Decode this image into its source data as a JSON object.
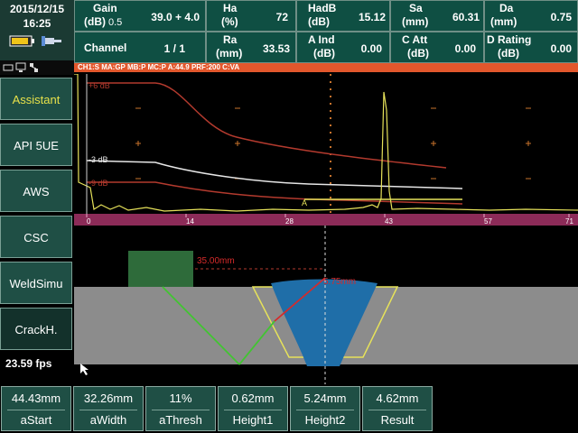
{
  "status": {
    "date": "2015/12/15",
    "time": "16:25"
  },
  "params": {
    "gain": {
      "label1": "Gain",
      "label2": "(dB)",
      "step": "0.5",
      "value": "39.0 + 4.0"
    },
    "channel": {
      "label": "Channel",
      "value": "1 / 1"
    },
    "ha": {
      "label1": "Ha",
      "label2": "(%)",
      "value": "72"
    },
    "hadb": {
      "label1": "HadB",
      "label2": "(dB)",
      "value": "15.12"
    },
    "sa": {
      "label1": "Sa",
      "label2": "(mm)",
      "value": "60.31"
    },
    "da": {
      "label1": "Da",
      "label2": "(mm)",
      "value": "0.75"
    },
    "ra": {
      "label1": "Ra",
      "label2": "(mm)",
      "value": "33.53"
    },
    "aind": {
      "label1": "A Ind",
      "label2": "(dB)",
      "value": "0.00"
    },
    "catt": {
      "label1": "C Att",
      "label2": "(dB)",
      "value": "0.00"
    },
    "drating": {
      "label1": "D Rating",
      "label2": "(dB)",
      "value": "0.00"
    }
  },
  "info_strip": "CH1:S MA:GP MB:P MC:P A:44.9 PRF:200 C:VA",
  "menu": [
    {
      "label": "Assistant",
      "active": true
    },
    {
      "label": "API 5UE"
    },
    {
      "label": "AWS"
    },
    {
      "label": "CSC"
    },
    {
      "label": "WeldSimu"
    },
    {
      "label": "CrackH.",
      "selected": true
    }
  ],
  "fps": "23.59 fps",
  "ascan": {
    "curve_labels": [
      "+6 dB",
      "-3 dB",
      "-9 dB"
    ],
    "gate_label": "A",
    "ruler_ticks": [
      "0",
      "14",
      "28",
      "43",
      "57",
      "71"
    ]
  },
  "section": {
    "dim1": "35.00mm",
    "dim2": "5.75mm"
  },
  "bottom": [
    {
      "value": "44.43mm",
      "label": "aStart"
    },
    {
      "value": "32.26mm",
      "label": "aWidth"
    },
    {
      "value": "11%",
      "label": "aThresh"
    },
    {
      "value": "0.62mm",
      "label": "Height1"
    },
    {
      "value": "5.24mm",
      "label": "Height2"
    },
    {
      "value": "4.62mm",
      "label": "Result"
    }
  ],
  "colors": {
    "panel": "#0f4f43",
    "info_strip": "#e2572c",
    "ruler": "#8c2b58",
    "active_text": "#e8e14a"
  }
}
